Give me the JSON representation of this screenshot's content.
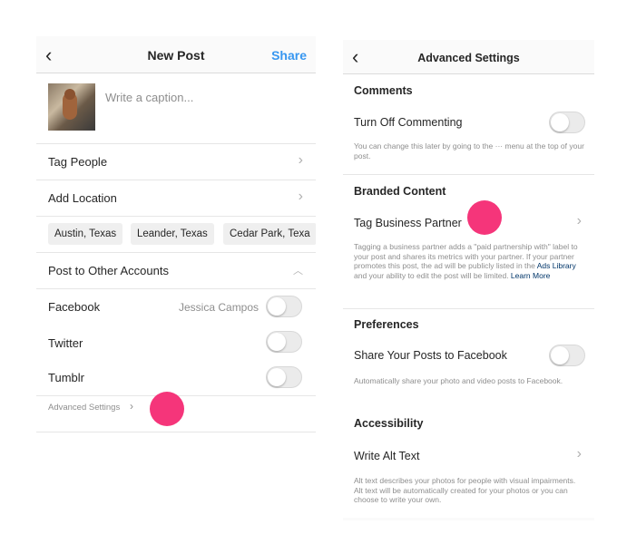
{
  "left": {
    "header": {
      "back_icon": "chevron-left-icon",
      "title": "New Post",
      "share_label": "Share"
    },
    "caption_placeholder": "Write a caption...",
    "tag_people": "Tag People",
    "add_location": "Add Location",
    "location_chips": [
      "Austin, Texas",
      "Leander, Texas",
      "Cedar Park, Texa"
    ],
    "post_to_other": "Post to Other Accounts",
    "accounts": [
      {
        "label": "Facebook",
        "account": "Jessica Campos",
        "on": false
      },
      {
        "label": "Twitter",
        "on": false
      },
      {
        "label": "Tumblr",
        "on": false
      }
    ],
    "advanced_link": "Advanced Settings"
  },
  "right": {
    "header": {
      "back_icon": "chevron-left-icon",
      "title": "Advanced Settings"
    },
    "comments": {
      "title": "Comments",
      "turn_off": "Turn Off Commenting",
      "note": "You can change this later by going to the ··· menu at the top of your post."
    },
    "branded": {
      "title": "Branded Content",
      "tag_partner": "Tag Business Partner",
      "note_before": "Tagging a business partner adds a \"paid partnership with\" label to your post and shares its metrics with your partner. If your partner promotes this post, the ad will be publicly listed in the ",
      "ads_library": "Ads Library",
      "note_middle": " and your ability to edit the post will be limited. ",
      "learn_more": "Learn More"
    },
    "preferences": {
      "title": "Preferences",
      "share_fb": "Share Your Posts to Facebook",
      "note": "Automatically share your photo and video posts to Facebook."
    },
    "accessibility": {
      "title": "Accessibility",
      "alt_text": "Write Alt Text",
      "note": "Alt text describes your photos for people with visual impairments. Alt text will be automatically created for your photos or you can choose to write your own."
    }
  },
  "colors": {
    "accent": "#3897f0",
    "highlight_dot": "#f5357a",
    "link": "#003569"
  }
}
